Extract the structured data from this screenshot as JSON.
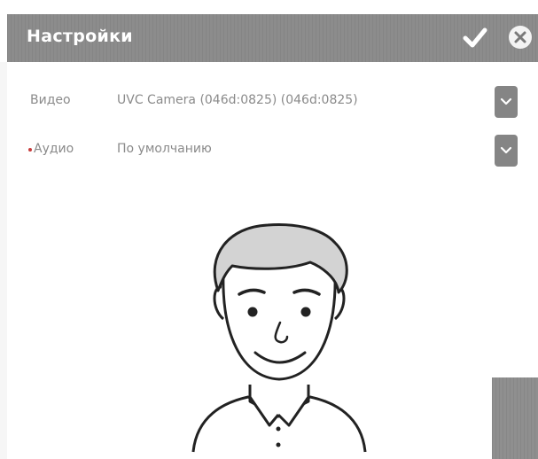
{
  "dialog": {
    "title": "Настройки"
  },
  "settings": {
    "rows": [
      {
        "label": "Видео",
        "value": "UVC Camera (046d:0825) (046d:0825)",
        "required": false
      },
      {
        "label": "Аудио",
        "value": "По умолчанию",
        "required": true
      }
    ]
  },
  "icons": {
    "confirm": "check-icon",
    "close": "close-circle-icon",
    "dropdown": "chevron-down-icon",
    "avatar": "user-avatar-illustration"
  },
  "colors": {
    "titlebar": "#8c8c8c",
    "title_text": "#ffffff",
    "dropdown_button": "#858585",
    "label_text": "#8a8a8a",
    "required_marker": "#c83c3c"
  }
}
